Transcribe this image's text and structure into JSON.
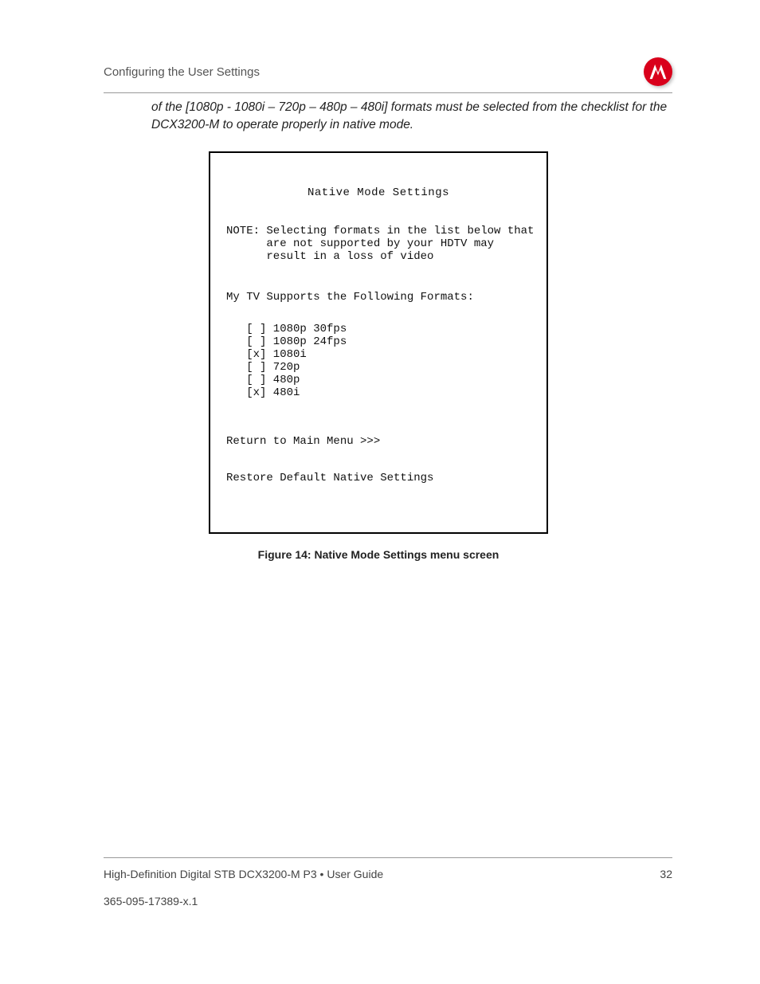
{
  "header": {
    "section_title": "Configuring the User Settings",
    "logo_name": "motorola-logo"
  },
  "body": {
    "continuation_text": "of the [1080p - 1080i – 720p – 480p – 480i] formats must be selected from the checklist for the DCX3200-M to operate properly in native mode."
  },
  "figure": {
    "caption": "Figure 14: Native Mode Settings menu screen",
    "screen": {
      "title": "Native Mode Settings",
      "note_label": "NOTE:",
      "note_lines": [
        "Selecting formats in the list below that",
        "are not supported by your HDTV may",
        "result in a loss of video"
      ],
      "supports_label": "My TV Supports the Following Formats:",
      "formats": [
        {
          "checked": false,
          "label": "1080p 30fps"
        },
        {
          "checked": false,
          "label": "1080p 24fps"
        },
        {
          "checked": true,
          "label": "1080i"
        },
        {
          "checked": false,
          "label": "720p"
        },
        {
          "checked": false,
          "label": "480p"
        },
        {
          "checked": true,
          "label": "480i"
        }
      ],
      "return_label": "Return to Main Menu >>>",
      "restore_label": "Restore Default Native Settings"
    }
  },
  "footer": {
    "product_line": "High-Definition Digital STB DCX3200-M P3 • User Guide",
    "page_number": "32",
    "doc_number": "365-095-17389-x.1"
  }
}
